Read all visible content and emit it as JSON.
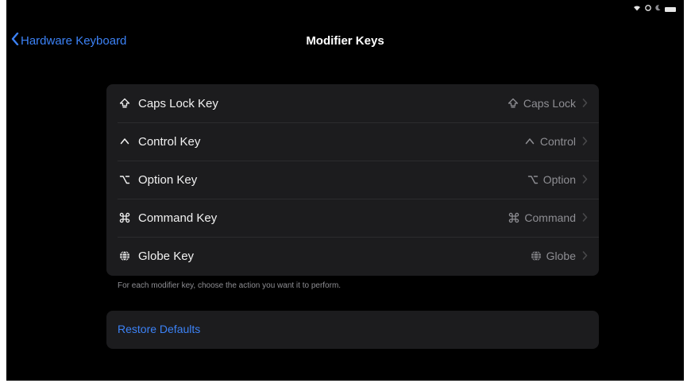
{
  "nav": {
    "back_label": "Hardware Keyboard",
    "title": "Modifier Keys"
  },
  "keys": [
    {
      "label": "Caps Lock Key",
      "value": "Caps Lock",
      "icon": "caps-lock-icon",
      "glyph": "⇪"
    },
    {
      "label": "Control Key",
      "value": "Control",
      "icon": "control-icon",
      "glyph": "^"
    },
    {
      "label": "Option Key",
      "value": "Option",
      "icon": "option-icon",
      "glyph": "⌥"
    },
    {
      "label": "Command Key",
      "value": "Command",
      "icon": "command-icon",
      "glyph": "⌘"
    },
    {
      "label": "Globe Key",
      "value": "Globe",
      "icon": "globe-icon",
      "glyph": "🌐"
    }
  ],
  "footnote": "For each modifier key, choose the action you want it to perform.",
  "restore_label": "Restore Defaults",
  "colors": {
    "accent": "#3c82f6",
    "background": "#000000",
    "group": "#1c1c1e",
    "secondary_text": "#8e8e93"
  }
}
